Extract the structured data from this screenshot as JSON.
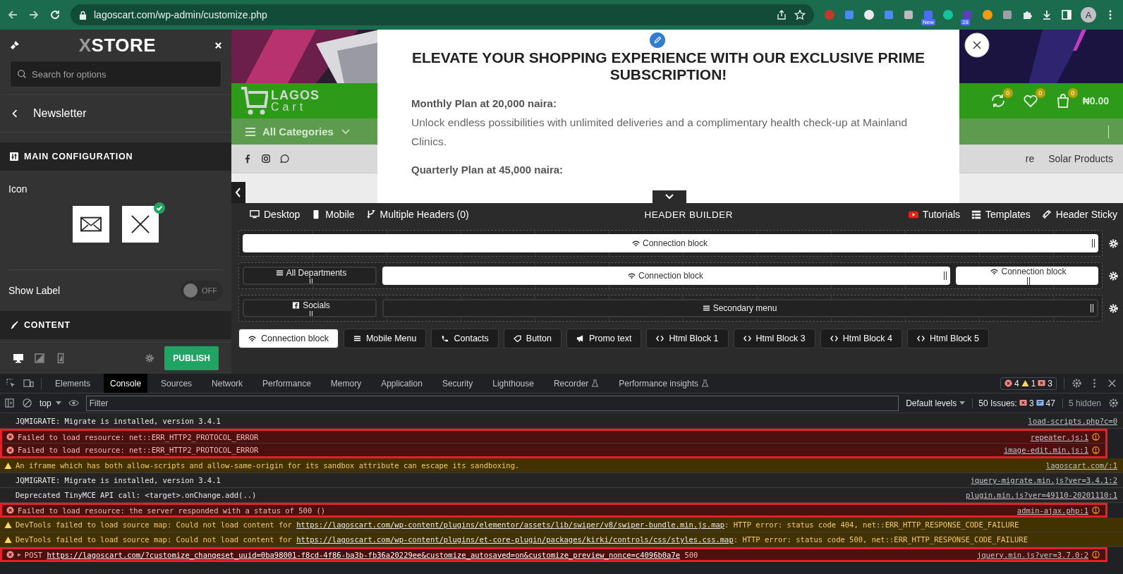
{
  "browser": {
    "url": "lagoscart.com/wp-admin/customize.php",
    "extensions": [
      {
        "kind": "recycle"
      },
      {
        "kind": "doc"
      },
      {
        "kind": "globe"
      },
      {
        "kind": "translate"
      },
      {
        "kind": "camera"
      },
      {
        "kind": "app",
        "badge": "New"
      },
      {
        "kind": "grammar"
      },
      {
        "kind": "hat",
        "badge": "28"
      },
      {
        "kind": "ball"
      },
      {
        "kind": "tool"
      },
      {
        "kind": "puzzle"
      }
    ],
    "avatar": "A"
  },
  "customizer": {
    "logo_mark": "X",
    "logo_text": "STORE",
    "search": {
      "placeholder": "Search for options"
    },
    "panel_title": "Newsletter",
    "section_main": "MAIN CONFIGURATION",
    "icon_label": "Icon",
    "icon_options": [
      {
        "kind": "envelope",
        "selected": false
      },
      {
        "kind": "cross",
        "selected": true
      }
    ],
    "show_label": {
      "label": "Show Label",
      "on": false,
      "state_text": "OFF"
    },
    "section_content": "CONTENT",
    "devices": [
      {
        "kind": "desktop",
        "selected": true
      },
      {
        "kind": "tablet",
        "selected": false
      },
      {
        "kind": "mobile",
        "selected": false
      }
    ],
    "publish": "PUBLISH"
  },
  "site": {
    "logo_top": "LAGOS",
    "logo_bottom": "Cart",
    "categories": "All Categories",
    "counters": [
      {
        "kind": "sync",
        "count": "0"
      },
      {
        "kind": "heart",
        "count": "0"
      },
      {
        "kind": "bag",
        "count": "0"
      }
    ],
    "cart_total": "₦0.00",
    "nav_items": [
      "re",
      "Solar Products"
    ]
  },
  "modal": {
    "title": "ELEVATE YOUR SHOPPING EXPERIENCE WITH OUR EXCLUSIVE PRIME SUBSCRIPTION!",
    "plans": [
      {
        "heading": "Monthly Plan at 20,000 naira:",
        "text": "Unlock endless possibilities with unlimited deliveries and a complimentary health check-up at Mainland Clinics."
      },
      {
        "heading": "Quarterly Plan at 45,000 naira:"
      }
    ]
  },
  "builder": {
    "modes": [
      {
        "kind": "desktop",
        "label": "Desktop"
      },
      {
        "kind": "mobile",
        "label": "Mobile"
      },
      {
        "kind": "branch",
        "label": "Multiple Headers (0)"
      }
    ],
    "title": "HEADER BUILDER",
    "links": [
      {
        "kind": "youtube",
        "label": "Tutorials"
      },
      {
        "kind": "grid",
        "label": "Templates"
      },
      {
        "kind": "link",
        "label": "Header Sticky"
      }
    ],
    "rows": [
      {
        "blocks": [
          {
            "label": "Connection block",
            "kind": "connection"
          }
        ]
      },
      {
        "blocks": [
          {
            "label": "All Departments",
            "kind": "menu"
          },
          {
            "label": "Connection block",
            "kind": "connection"
          },
          {
            "label": "Connection block",
            "kind": "connection"
          }
        ]
      },
      {
        "blocks": [
          {
            "label": "Socials",
            "kind": "facebook"
          },
          {
            "label": "Secondary menu",
            "kind": "menu"
          }
        ]
      }
    ],
    "tray": [
      {
        "label": "Connection block",
        "kind": "connection",
        "selected": true
      },
      {
        "label": "Mobile Menu",
        "kind": "menu",
        "selected": false
      },
      {
        "label": "Contacts",
        "kind": "phone",
        "selected": false
      },
      {
        "label": "Button",
        "kind": "tag",
        "selected": false
      },
      {
        "label": "Promo text",
        "kind": "megaphone",
        "selected": false
      },
      {
        "label": "Html Block 1",
        "kind": "code",
        "selected": false
      },
      {
        "label": "Html Block 3",
        "kind": "code",
        "selected": false
      },
      {
        "label": "Html Block 4",
        "kind": "code",
        "selected": false
      },
      {
        "label": "Html Block 5",
        "kind": "code",
        "selected": false
      }
    ]
  },
  "devtools": {
    "tabs": [
      {
        "label": "Elements",
        "selected": false
      },
      {
        "label": "Console",
        "selected": true
      },
      {
        "label": "Sources",
        "selected": false
      },
      {
        "label": "Network",
        "selected": false
      },
      {
        "label": "Performance",
        "selected": false
      },
      {
        "label": "Memory",
        "selected": false
      },
      {
        "label": "Application",
        "selected": false
      },
      {
        "label": "Security",
        "selected": false
      },
      {
        "label": "Lighthouse",
        "selected": false
      },
      {
        "label": "Recorder",
        "selected": false,
        "flask": true
      },
      {
        "label": "Performance insights",
        "selected": false,
        "flask": true
      }
    ],
    "errors": "4",
    "warnings": "1",
    "issues": "3",
    "context": "top",
    "filter": {
      "placeholder": "Filter"
    },
    "levels": "Default levels",
    "issues_label": "50 Issues:",
    "issues_errors": "3",
    "issues_info": "47",
    "hidden": "5 hidden",
    "messages": [
      {
        "kind": "log",
        "text": "JQMIGRATE: Migrate is installed, version 3.4.1",
        "source": "load-scripts.php?c=0",
        "highlighted": false
      },
      {
        "kind": "error",
        "text": "Failed to load resource: net::ERR_HTTP2_PROTOCOL_ERROR",
        "source": "repeater.js:1",
        "highlighted": true
      },
      {
        "kind": "error",
        "text": "Failed to load resource: net::ERR_HTTP2_PROTOCOL_ERROR",
        "source": "image-edit.min.js:1",
        "highlighted": true
      },
      {
        "kind": "warning",
        "text": "An iframe which has both allow-scripts and allow-same-origin for its sandbox attribute can escape its sandboxing.",
        "source": "lagoscart.com/:1",
        "highlighted": false
      },
      {
        "kind": "log",
        "text": "JQMIGRATE: Migrate is installed, version 3.4.1",
        "source": "jquery-migrate.min.js?ver=3.4.1:2",
        "highlighted": false
      },
      {
        "kind": "log",
        "text": "Deprecated TinyMCE API call: <target>.onChange.add(..)",
        "source": "plugin.min.js?ver=49110-20201110:1",
        "highlighted": false
      },
      {
        "kind": "error",
        "text": "Failed to load resource: the server responded with a status of 500 ()",
        "source": "admin-ajax.php:1",
        "highlighted": true
      },
      {
        "kind": "warning",
        "text": "DevTools failed to load source map: Could not load content for",
        "link": "https://lagoscart.com/wp-content/plugins/elementor/assets/lib/swiper/v8/swiper-bundle.min.js.map",
        "after": ": HTTP error: status code 404, net::ERR_HTTP_RESPONSE_CODE_FAILURE",
        "highlighted": false
      },
      {
        "kind": "warning",
        "text": "DevTools failed to load source map: Could not load content for",
        "link": "https://lagoscart.com/wp-content/plugins/et-core-plugin/packages/kirki/controls/css/styles.css.map",
        "after": ": HTTP error: status code 500, net::ERR_HTTP_RESPONSE_CODE_FAILURE",
        "highlighted": false
      },
      {
        "kind": "error",
        "expand": "▶",
        "text": "POST",
        "link": "https://lagoscart.com/?customize_changeset_uuid=0ba98001-f8cd-4f86-ba3b-fb36a20229ee&customize_autosaved=on&customize_preview_nonce=c4096b0a7e",
        "after": " 500",
        "source": "jquery.min.js?ver=3.7.0:2",
        "highlighted": true
      }
    ]
  }
}
